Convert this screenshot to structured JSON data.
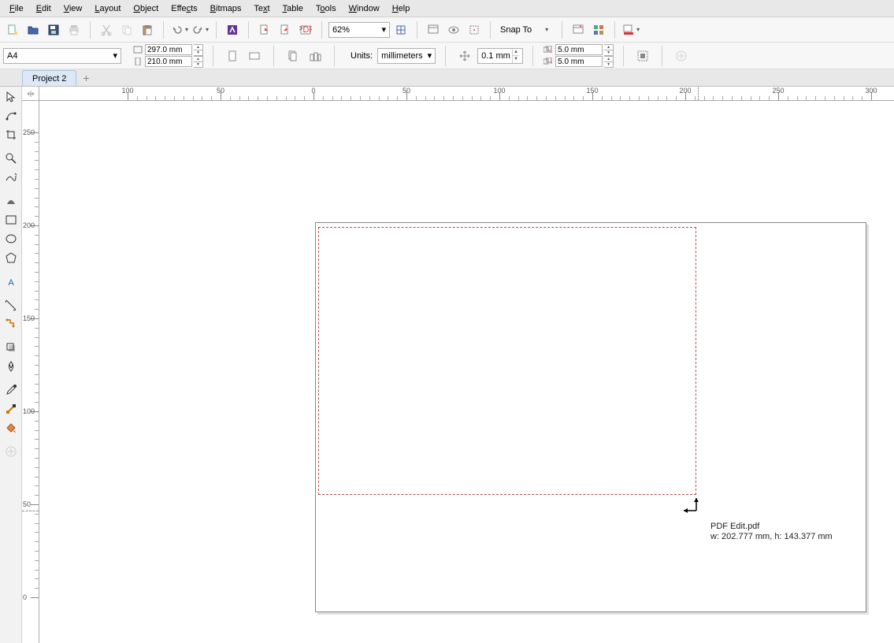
{
  "menu": {
    "file": "File",
    "edit": "Edit",
    "view": "View",
    "layout": "Layout",
    "object": "Object",
    "effects": "Effects",
    "bitmaps": "Bitmaps",
    "text": "Text",
    "table": "Table",
    "tools": "Tools",
    "window": "Window",
    "help": "Help"
  },
  "toolbar1": {
    "zoom_value": "62%",
    "snap_label": "Snap To"
  },
  "propbar": {
    "page_preset": "A4",
    "width": "297.0 mm",
    "height": "210.0 mm",
    "units_label": "Units:",
    "units_value": "millimeters",
    "nudge": "0.1 mm",
    "dup_x": "5.0 mm",
    "dup_y": "5.0 mm"
  },
  "tab": {
    "name": "Project 2"
  },
  "ruler_h": {
    "labels": [
      "100",
      "50",
      "0",
      "50",
      "100",
      "150",
      "200",
      "250",
      "300"
    ],
    "positions": [
      112,
      230,
      348,
      466,
      584,
      702,
      820,
      938,
      1056
    ],
    "marker": 836
  },
  "ruler_v": {
    "labels": [
      "250",
      "200",
      "150",
      "100",
      "50",
      "0"
    ],
    "positions": [
      40,
      158,
      276,
      394,
      512,
      630
    ],
    "dash": 520
  },
  "canvas": {
    "filename": "PDF Edit.pdf",
    "dimensions": "w: 202.777 mm, h: 143.377 mm"
  }
}
